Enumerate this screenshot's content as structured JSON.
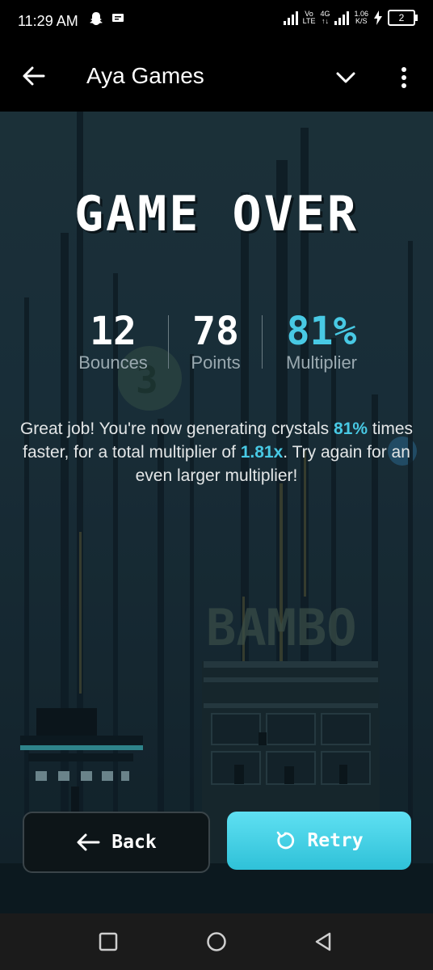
{
  "status_bar": {
    "time": "11:29 AM",
    "icons": [
      "snapchat-icon",
      "message-icon"
    ],
    "network_vo": "Vo",
    "network_lte": "LTE",
    "network_4g": "4G",
    "speed_value": "1.06",
    "speed_unit": "K/S",
    "battery_level": "2"
  },
  "app_bar": {
    "title": "Aya Games",
    "back_icon": "arrow-left-icon",
    "chevron_icon": "chevron-down-icon",
    "more_icon": "more-vert-icon"
  },
  "game": {
    "heading": "GAME OVER",
    "stats": {
      "bounces": {
        "value": "12",
        "label": "Bounces"
      },
      "points": {
        "value": "78",
        "label": "Points"
      },
      "multiplier": {
        "value": "81%",
        "label": "Multiplier"
      }
    },
    "message": {
      "part1": "Great job! You're now generating crystals ",
      "highlight1": "81%",
      "part2": " times faster, for a total multiplier of ",
      "highlight2": "1.81x",
      "part3": ". Try again for an even larger multiplier!"
    },
    "back_button": "Back",
    "retry_button": "Retry",
    "background_sign": "BAMBO",
    "accent_color": "#48c9e4"
  },
  "nav_bar": {
    "icons": [
      "recents-square-icon",
      "home-circle-icon",
      "back-triangle-icon"
    ]
  }
}
